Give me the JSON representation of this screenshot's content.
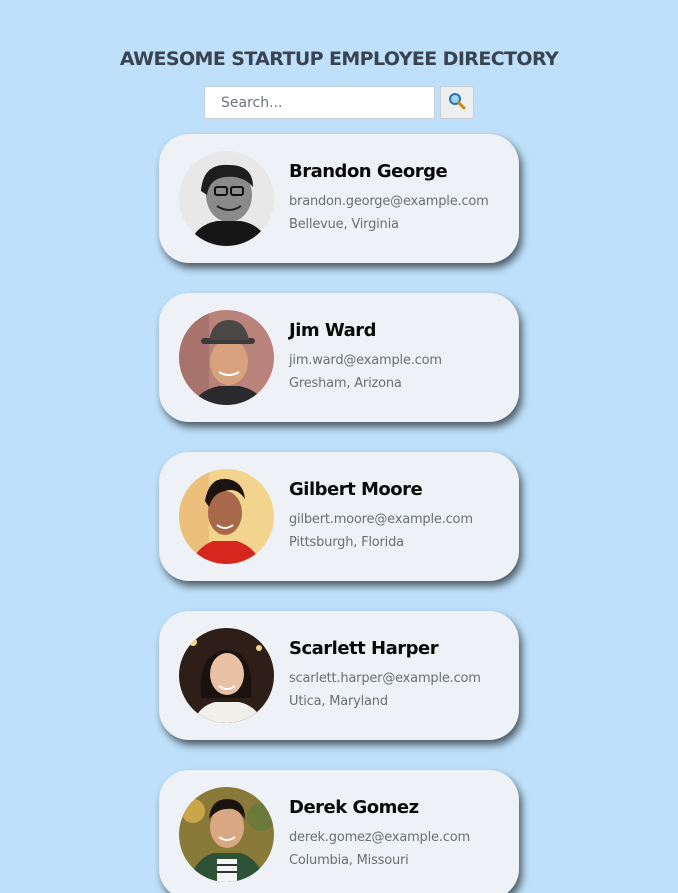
{
  "header": {
    "title": "AWESOME STARTUP EMPLOYEE DIRECTORY"
  },
  "search": {
    "placeholder": "Search...",
    "value": "",
    "button_icon": "magnifier-icon"
  },
  "employees": [
    {
      "name": "Brandon George",
      "email": "brandon.george@example.com",
      "location": "Bellevue, Virginia"
    },
    {
      "name": "Jim Ward",
      "email": "jim.ward@example.com",
      "location": "Gresham, Arizona"
    },
    {
      "name": "Gilbert Moore",
      "email": "gilbert.moore@example.com",
      "location": "Pittsburgh, Florida"
    },
    {
      "name": "Scarlett Harper",
      "email": "scarlett.harper@example.com",
      "location": "Utica, Maryland"
    },
    {
      "name": "Derek Gomez",
      "email": "derek.gomez@example.com",
      "location": "Columbia, Missouri"
    }
  ],
  "colors": {
    "background": "#bee0fa",
    "card": "#eef2f6",
    "title": "#3a4350"
  }
}
